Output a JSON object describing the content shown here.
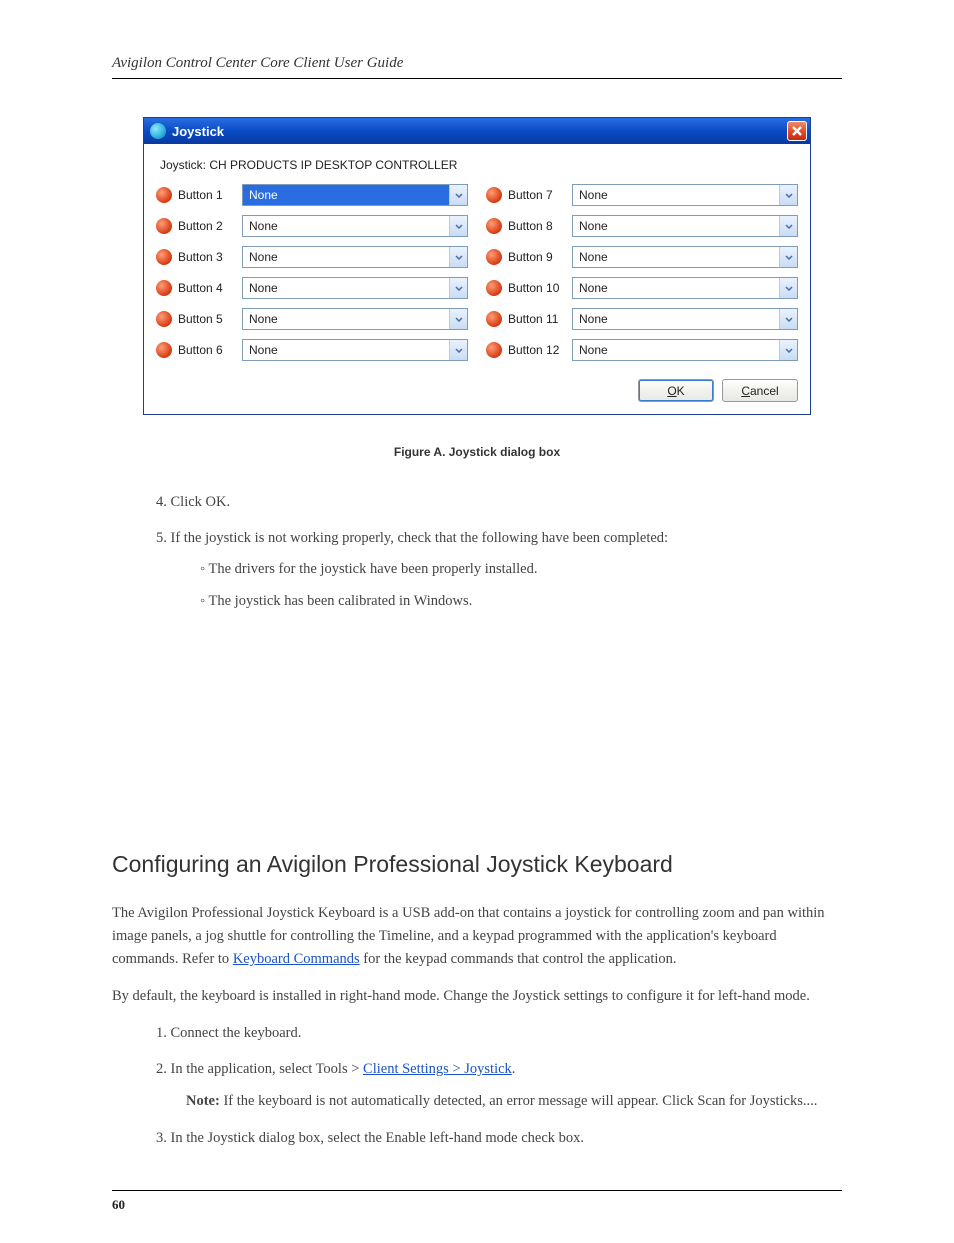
{
  "header": "Avigilon Control Center Core Client User Guide",
  "dialog": {
    "title": "Joystick",
    "device_label": "Joystick: CH PRODUCTS IP DESKTOP CONTROLLER",
    "ok": "OK",
    "cancel": "Cancel",
    "left_buttons": [
      {
        "label": "Button 1",
        "value": "None",
        "selected": true
      },
      {
        "label": "Button 2",
        "value": "None",
        "selected": false
      },
      {
        "label": "Button 3",
        "value": "None",
        "selected": false
      },
      {
        "label": "Button 4",
        "value": "None",
        "selected": false
      },
      {
        "label": "Button 5",
        "value": "None",
        "selected": false
      },
      {
        "label": "Button 6",
        "value": "None",
        "selected": false
      }
    ],
    "right_buttons": [
      {
        "label": "Button 7",
        "value": "None",
        "selected": false
      },
      {
        "label": "Button 8",
        "value": "None",
        "selected": false
      },
      {
        "label": "Button 9",
        "value": "None",
        "selected": false
      },
      {
        "label": "Button 10",
        "value": "None",
        "selected": false
      },
      {
        "label": "Button 11",
        "value": "None",
        "selected": false
      },
      {
        "label": "Button 12",
        "value": "None",
        "selected": false
      }
    ]
  },
  "figure_caption": "Figure A. Joystick dialog box",
  "step4": "4.    Click OK.",
  "step5_lead": "5.    If the joystick is not working properly, check that the following have been completed:",
  "step5a": "◦  The drivers for the joystick have been properly installed.",
  "step5b": "◦  The joystick has been calibrated in Windows.",
  "section_heading": "Configuring an Avigilon Professional Joystick Keyboard",
  "para1_a": "The Avigilon Professional Joystick Keyboard is a USB add-on that contains a joystick for controlling zoom and pan within image panels, a jog shuttle for controlling the Timeline, and a keypad programmed with the application's keyboard commands. Refer to ",
  "para1_link": "Keyboard Commands",
  "para1_b": " for the keypad commands that control the application.",
  "para2": "By default, the keyboard is installed in right-hand mode. Change the Joystick settings to configure it for left-hand mode.",
  "step1_begin": "1.    Connect the keyboard.",
  "step2_begin": "2.    In the application, select Tools > ",
  "step2_link": "Client Settings > Joystick",
  "step2_end": ".",
  "note_label": "Note:",
  "note_text": " If the keyboard is not automatically detected, an error message will appear. Click Scan for Joysticks....",
  "step3_begin": "3.    In the Joystick dialog box, select the Enable left-hand mode check box.",
  "page_number": "60"
}
